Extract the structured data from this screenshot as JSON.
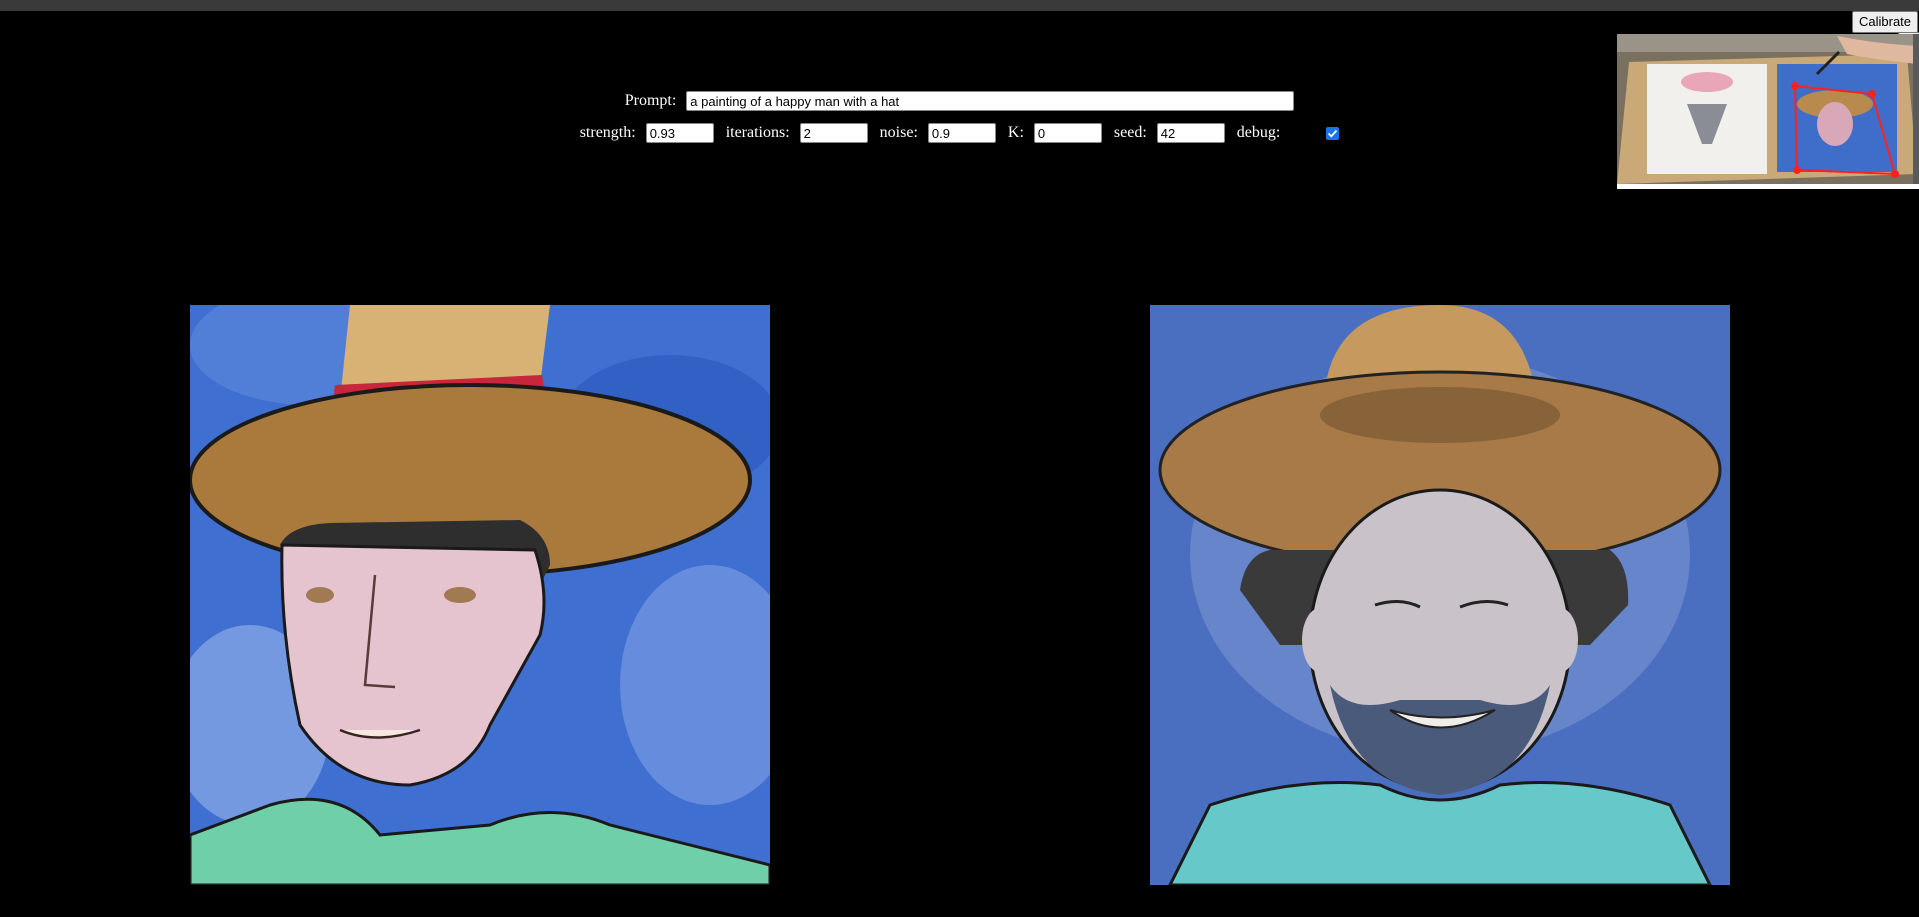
{
  "toolbar": {
    "calibrate_label": "Calibrate",
    "help_label": "?"
  },
  "controls": {
    "prompt_label": "Prompt:",
    "prompt_value": "a painting of a happy man with a hat",
    "strength_label": "strength:",
    "strength_value": "0.93",
    "iterations_label": "iterations:",
    "iterations_value": "2",
    "noise_label": "noise:",
    "noise_value": "0.9",
    "k_label": "K:",
    "k_value": "0",
    "seed_label": "seed:",
    "seed_value": "42",
    "debug_label": "debug:",
    "debug_checked": true
  },
  "colors": {
    "background": "#000000",
    "checkbox_accent": "#1a73e8",
    "calibration_points": "#ff2020"
  },
  "images": {
    "camera_preview": "camera-preview-of-painting-setup",
    "input_painting": "watercolor-man-with-hat",
    "generated_output": "generated-happy-bearded-man-with-hat"
  }
}
